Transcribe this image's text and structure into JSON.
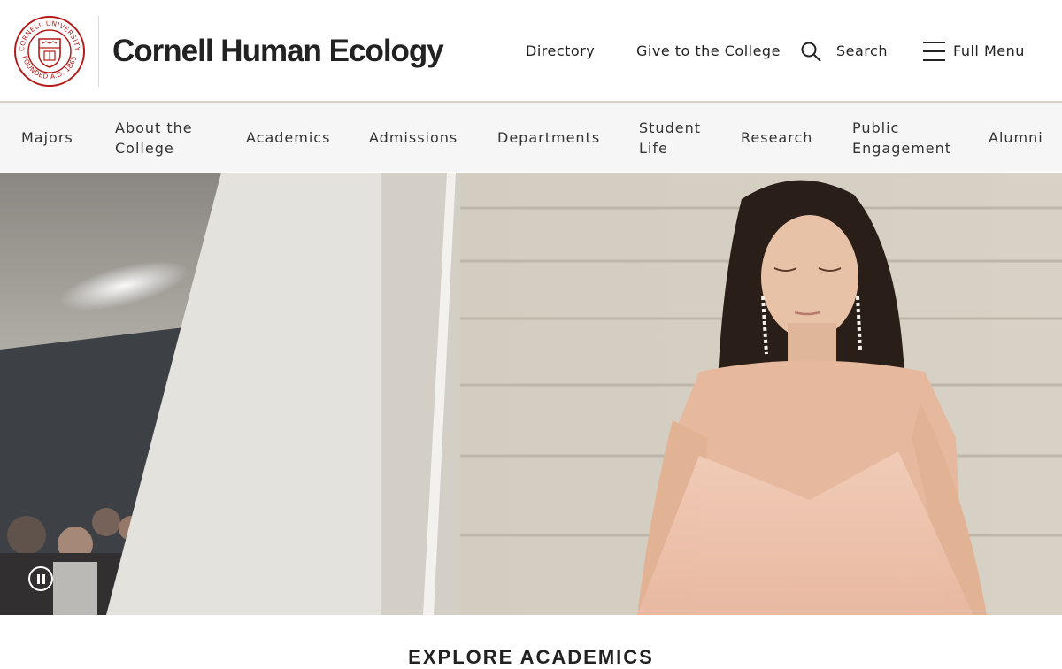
{
  "header": {
    "seal_text_top": "CORNELL UNIVERSITY",
    "seal_text_bottom": "FOUNDED A.D. 1865",
    "title": "Cornell Human Ecology",
    "links": {
      "directory": "Directory",
      "give": "Give to the College",
      "search": "Search",
      "menu": "Full Menu"
    }
  },
  "nav": {
    "items": [
      "Majors",
      "About the College",
      "Academics",
      "Admissions",
      "Departments",
      "Student Life",
      "Research",
      "Public Engagement",
      "Alumni"
    ]
  },
  "hero": {
    "pause_icon": "pause-icon"
  },
  "section": {
    "heading": "EXPLORE ACADEMICS"
  },
  "colors": {
    "brand_red": "#b31b1b",
    "nav_bg": "#f6f6f6"
  }
}
